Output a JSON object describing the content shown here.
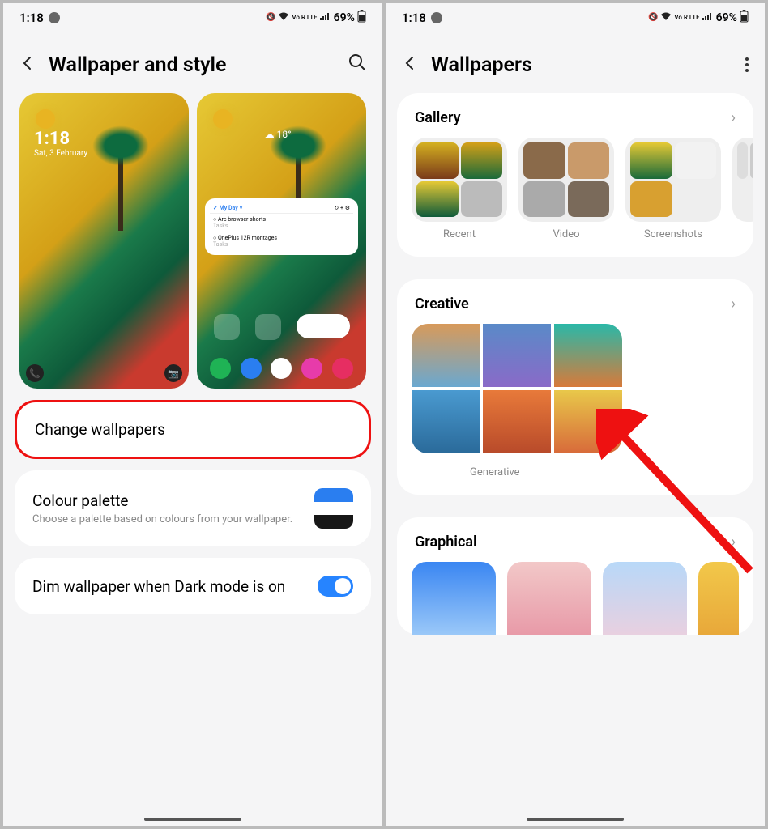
{
  "status": {
    "time": "1:18",
    "indicators": "Vo R LTE",
    "battery": "69%"
  },
  "left_screen": {
    "header_title": "Wallpaper and style",
    "lock_preview": {
      "time": "1:18",
      "date": "Sat, 3 February"
    },
    "home_preview": {
      "weather_temp": "18°",
      "widget_title": "My Day",
      "widget_items": [
        "Arc browser shorts",
        "OnePlus 12R montages"
      ],
      "widget_sub": "Tasks"
    },
    "change_wallpapers": "Change wallpapers",
    "palette": {
      "title": "Colour palette",
      "sub": "Choose a palette based on colours from your wallpaper.",
      "colors": [
        "#2a7ef0",
        "#ffffff",
        "#171717"
      ]
    },
    "dim": {
      "title": "Dim wallpaper when Dark mode is on",
      "on": true
    }
  },
  "right_screen": {
    "header_title": "Wallpapers",
    "gallery": {
      "title": "Gallery",
      "items": [
        "Recent",
        "Video",
        "Screenshots"
      ]
    },
    "creative": {
      "title": "Creative",
      "item": "Generative"
    },
    "graphical": {
      "title": "Graphical"
    }
  }
}
